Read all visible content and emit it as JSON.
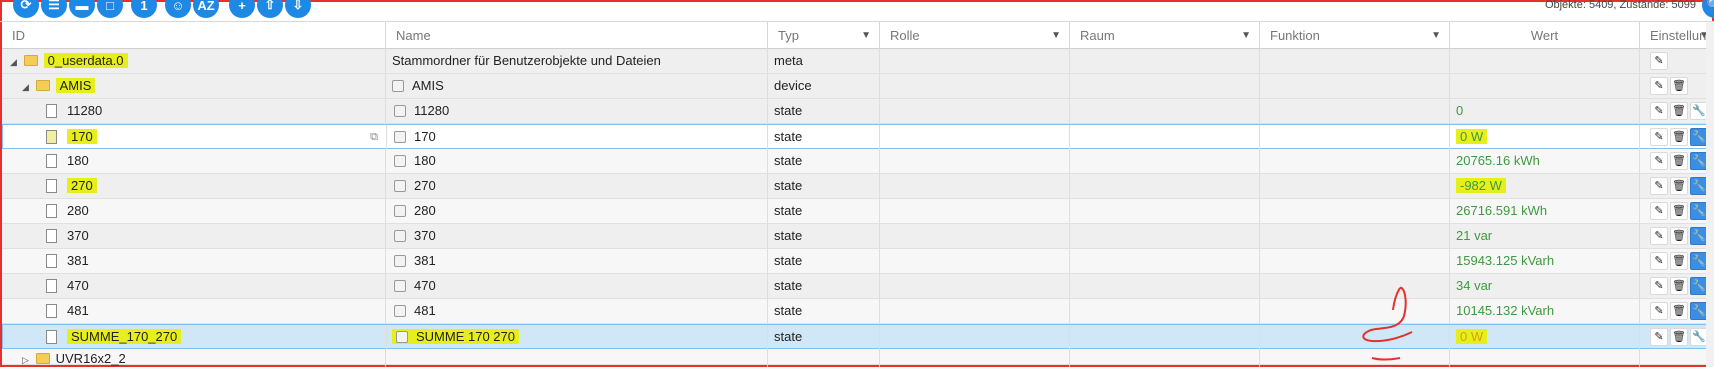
{
  "toolbar": {
    "buttons": [
      "refresh-icon",
      "list-icon",
      "file-icon",
      "square-icon",
      "file-number-icon",
      "person-icon",
      "sort-az-icon",
      "add-icon",
      "upload-icon",
      "download-icon"
    ],
    "sort_label": "AZ",
    "counts_text": "Objekte: 5409, Zustände: 5099"
  },
  "header": {
    "id": "ID",
    "name": "Name",
    "typ": "Typ",
    "rolle": "Rolle",
    "raum": "Raum",
    "funktion": "Funktion",
    "wert": "Wert",
    "einstellungen": "Einstellun"
  },
  "rows": [
    {
      "id": "0_userdata.0",
      "name": "Stammordner für Benutzerobjekte und Dateien",
      "typ": "meta",
      "wert": ""
    },
    {
      "id": "AMIS",
      "name": "AMIS",
      "typ": "device",
      "wert": ""
    },
    {
      "id": "11280",
      "name": "11280",
      "typ": "state",
      "wert": "0"
    },
    {
      "id": "170",
      "name": "170",
      "typ": "state",
      "wert": "0 W"
    },
    {
      "id": "180",
      "name": "180",
      "typ": "state",
      "wert": "20765.16 kWh"
    },
    {
      "id": "270",
      "name": "270",
      "typ": "state",
      "wert": "-982 W"
    },
    {
      "id": "280",
      "name": "280",
      "typ": "state",
      "wert": "26716.591 kWh"
    },
    {
      "id": "370",
      "name": "370",
      "typ": "state",
      "wert": "21 var"
    },
    {
      "id": "381",
      "name": "381",
      "typ": "state",
      "wert": "15943.125 kVarh"
    },
    {
      "id": "470",
      "name": "470",
      "typ": "state",
      "wert": "34 var"
    },
    {
      "id": "481",
      "name": "481",
      "typ": "state",
      "wert": "10145.132 kVarh"
    },
    {
      "id": "SUMME_170_270",
      "name": "SUMME 170 270",
      "typ": "state",
      "wert": "0 W"
    },
    {
      "id": "UVR16x2_2",
      "name": "",
      "typ": "",
      "wert": ""
    }
  ],
  "colors": {
    "value_green": "#3e9a3e",
    "highlight_yellow": "#e6ef1c",
    "accent_blue": "#1e88e5",
    "annotation_red": "#e53030"
  }
}
